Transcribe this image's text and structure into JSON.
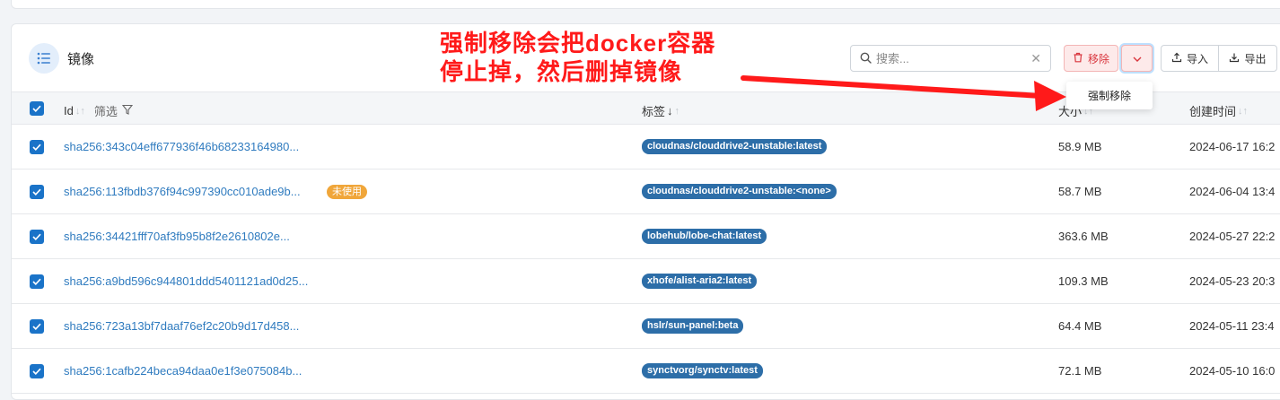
{
  "panel": {
    "title": "镜像"
  },
  "search": {
    "placeholder": "搜索..."
  },
  "toolbar": {
    "remove_label": "移除",
    "import_label": "导入",
    "export_label": "导出"
  },
  "dropdown": {
    "force_remove_label": "强制移除"
  },
  "table": {
    "headers": {
      "id": "Id",
      "filter": "筛选",
      "tags": "标签",
      "size": "大小",
      "created": "创建时间"
    },
    "rows": [
      {
        "id": "sha256:343c04eff677936f46b68233164980...",
        "badge": "",
        "tag": "cloudnas/clouddrive2-unstable:latest",
        "size": "58.9 MB",
        "created": "2024-06-17 16:2"
      },
      {
        "id": "sha256:113fbdb376f94c997390cc010ade9b...",
        "badge": "未使用",
        "tag": "cloudnas/clouddrive2-unstable:<none>",
        "size": "58.7 MB",
        "created": "2024-06-04 13:4"
      },
      {
        "id": "sha256:34421fff70af3fb95b8f2e2610802e...",
        "badge": "",
        "tag": "lobehub/lobe-chat:latest",
        "size": "363.6 MB",
        "created": "2024-05-27 22:2"
      },
      {
        "id": "sha256:a9bd596c944801ddd5401121ad0d25...",
        "badge": "",
        "tag": "xhofe/alist-aria2:latest",
        "size": "109.3 MB",
        "created": "2024-05-23 20:3"
      },
      {
        "id": "sha256:723a13bf7daaf76ef2c20b9d17d458...",
        "badge": "",
        "tag": "hslr/sun-panel:beta",
        "size": "64.4 MB",
        "created": "2024-05-11 23:4"
      },
      {
        "id": "sha256:1cafb224beca94daa0e1f3e075084b...",
        "badge": "",
        "tag": "synctvorg/synctv:latest",
        "size": "72.1 MB",
        "created": "2024-05-10 16:0"
      }
    ]
  },
  "annotation": {
    "line1": "强制移除会把docker容器",
    "line2": "停止掉，然后删掉镜像"
  },
  "colors": {
    "accent": "#1a73c8",
    "danger": "#d9363e",
    "tag_bg": "#2d6ea8",
    "unused_badge": "#f0a63a",
    "annotation": "#ff1a1a"
  }
}
